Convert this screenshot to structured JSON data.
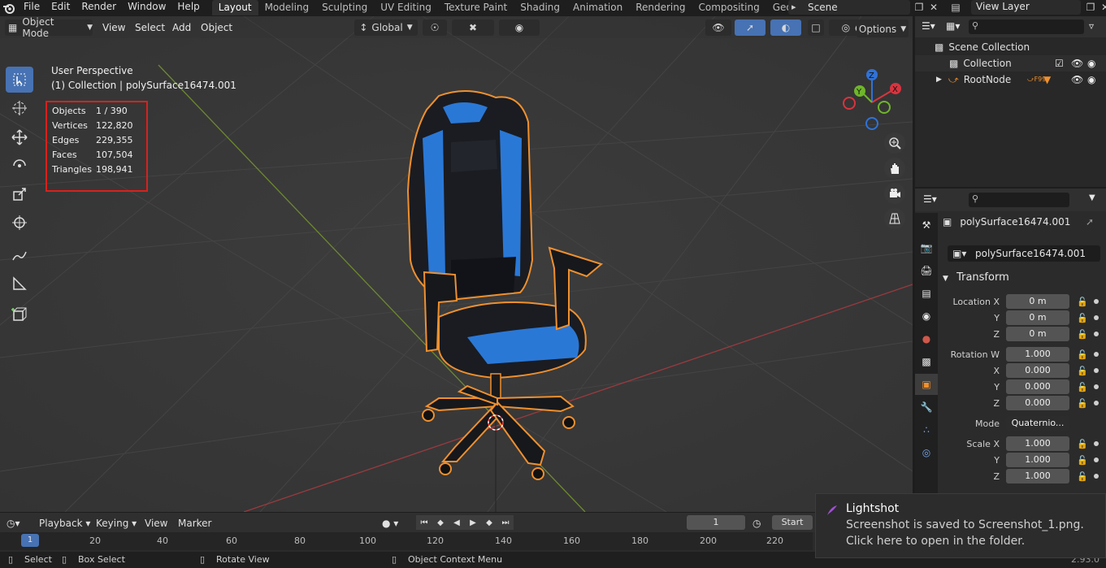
{
  "menu": {
    "items": [
      "File",
      "Edit",
      "Render",
      "Window",
      "Help"
    ]
  },
  "workspaces": [
    "Layout",
    "Modeling",
    "Sculpting",
    "UV Editing",
    "Texture Paint",
    "Shading",
    "Animation",
    "Rendering",
    "Compositing",
    "Geometry Nod"
  ],
  "scene": {
    "name": "Scene"
  },
  "view_layer": {
    "name": "View Layer"
  },
  "viewport": {
    "mode": "Object Mode",
    "menus": [
      "View",
      "Select",
      "Add",
      "Object"
    ],
    "transform_orientation": "Global",
    "options_label": "Options",
    "perspective": "User Perspective",
    "active": "(1) Collection | polySurface16474.001",
    "stats": [
      {
        "label": "Objects",
        "value": "1 / 390"
      },
      {
        "label": "Vertices",
        "value": "122,820"
      },
      {
        "label": "Edges",
        "value": "229,355"
      },
      {
        "label": "Faces",
        "value": "107,504"
      },
      {
        "label": "Triangles",
        "value": "198,941"
      }
    ],
    "gizmo": {
      "x": "X",
      "y": "Y",
      "z": "Z"
    }
  },
  "outliner": {
    "scene_collection": "Scene Collection",
    "collection": "Collection",
    "root_node": "RootNode",
    "badge": "F99"
  },
  "properties": {
    "object_name": "polySurface16474.001",
    "data_name": "polySurface16474.001",
    "panel": "Transform",
    "rows": [
      {
        "label": "Location X",
        "value": "0 m"
      },
      {
        "label": "Y",
        "value": "0 m"
      },
      {
        "label": "Z",
        "value": "0 m"
      },
      {
        "label": "Rotation W",
        "value": "1.000"
      },
      {
        "label": "X",
        "value": "0.000"
      },
      {
        "label": "Y",
        "value": "0.000"
      },
      {
        "label": "Z",
        "value": "0.000"
      },
      {
        "label": "Mode",
        "value": "Quaternio..."
      },
      {
        "label": "Scale X",
        "value": "1.000"
      },
      {
        "label": "Y",
        "value": "1.000"
      },
      {
        "label": "Z",
        "value": "1.000"
      }
    ]
  },
  "timeline": {
    "menus": [
      "Playback",
      "Keying",
      "View",
      "Marker"
    ],
    "current_frame": "1",
    "start_label": "Start",
    "ruler": [
      "20",
      "40",
      "60",
      "80",
      "100",
      "120",
      "140",
      "160",
      "180",
      "200",
      "220"
    ],
    "frame_marker": "1"
  },
  "statusbar": {
    "select": "Select",
    "box_select": "Box Select",
    "rotate_view": "Rotate View",
    "context_menu": "Object Context Menu",
    "version": "2.93.0"
  },
  "notification": {
    "title": "Lightshot",
    "line1": "Screenshot is saved to Screenshot_1.png.",
    "line2": "Click here to open in the folder."
  },
  "colors": {
    "accent": "#4772b3",
    "selection_outline": "#f0902e",
    "stats_box": "#d8211d",
    "chair_blue": "#2a78d6"
  }
}
